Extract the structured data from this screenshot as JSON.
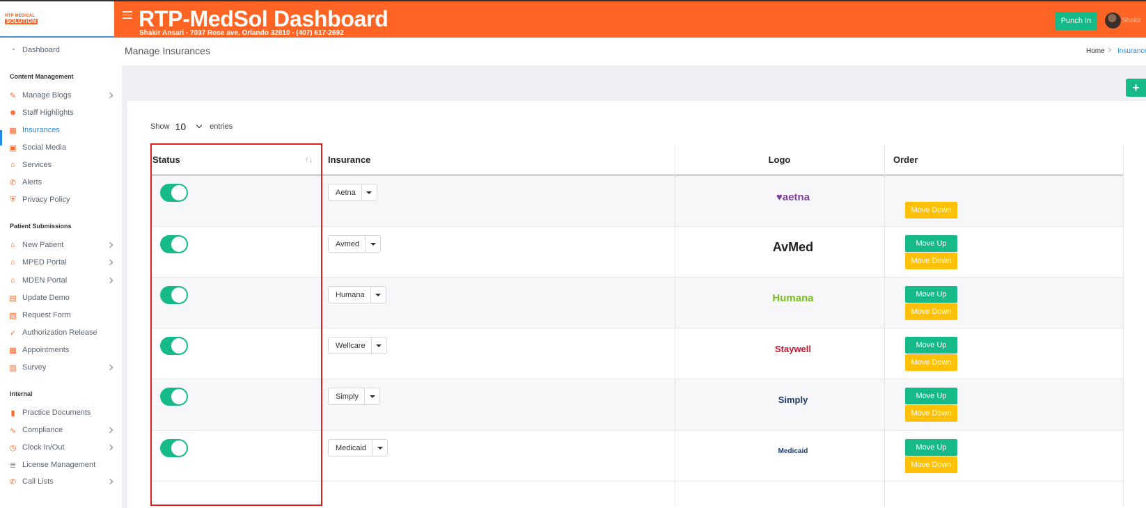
{
  "header": {
    "logo_line1": "RTP MEDICAL",
    "logo_line2": "SOLUTION",
    "title": "RTP-MedSol Dashboard",
    "subtitle": "Shakir Ansari - 7037 Rose ave, Orlando 32810 - (407) 617-2692",
    "punch_label": "Punch In",
    "user_name": "Shakir"
  },
  "sidebar": {
    "dashboard": "Dashboard",
    "sections": [
      "Content Management",
      "Patient Submissions",
      "Internal"
    ],
    "items": [
      {
        "label": "Manage Blogs",
        "icon": "blog-icon",
        "chevron": true
      },
      {
        "label": "Staff Highlights",
        "icon": "staff-icon",
        "chevron": false
      },
      {
        "label": "Insurances",
        "icon": "building-icon",
        "chevron": false,
        "active": true
      },
      {
        "label": "Social Media",
        "icon": "social-icon",
        "chevron": false
      },
      {
        "label": "Services",
        "icon": "bell-service-icon",
        "chevron": false
      },
      {
        "label": "Alerts",
        "icon": "phone-icon",
        "chevron": false
      },
      {
        "label": "Privacy Policy",
        "icon": "shield-icon",
        "chevron": false
      },
      {
        "label": "New Patient",
        "icon": "home-icon",
        "chevron": true
      },
      {
        "label": "MPED Portal",
        "icon": "home-icon",
        "chevron": true
      },
      {
        "label": "MDEN Portal",
        "icon": "home-icon",
        "chevron": true
      },
      {
        "label": "Update Demo",
        "icon": "id-card-icon",
        "chevron": false
      },
      {
        "label": "Request Form",
        "icon": "file-icon",
        "chevron": false
      },
      {
        "label": "Authorization Release",
        "icon": "check-doc-icon",
        "chevron": false
      },
      {
        "label": "Appointments",
        "icon": "calendar-icon",
        "chevron": false
      },
      {
        "label": "Survey",
        "icon": "chart-icon",
        "chevron": true
      },
      {
        "label": "Practice Documents",
        "icon": "clipboard-icon",
        "chevron": false
      },
      {
        "label": "Compliance",
        "icon": "signature-icon",
        "chevron": true
      },
      {
        "label": "Clock In/Out",
        "icon": "clock-icon",
        "chevron": true
      },
      {
        "label": "License Management",
        "icon": "list-icon",
        "chevron": false
      },
      {
        "label": "Call Lists",
        "icon": "phone-icon",
        "chevron": true
      }
    ]
  },
  "page": {
    "title": "Manage Insurances",
    "breadcrumb_home": "Home",
    "breadcrumb_current": "Insurance",
    "add_label": "+",
    "show_label": "Show",
    "entries_value": "10",
    "entries_label": "entries"
  },
  "table": {
    "headers": [
      "Status",
      "Insurance",
      "Logo",
      "Order"
    ],
    "sort_glyph": "↑↓",
    "move_up_label": "Move Up",
    "move_down_label": "Move Down",
    "rows": [
      {
        "name": "Aetna",
        "logo_text": "♥aetna",
        "logo_color": "#7d3f98",
        "active": true,
        "has_up": false
      },
      {
        "name": "Avmed",
        "logo_text": "AvMed",
        "logo_color": "#222222",
        "active": true,
        "has_up": true
      },
      {
        "name": "Humana",
        "logo_text": "Humana",
        "logo_color": "#78be20",
        "active": true,
        "has_up": true
      },
      {
        "name": "Wellcare",
        "logo_text": "Staywell",
        "logo_color": "#c8102e",
        "active": true,
        "has_up": true
      },
      {
        "name": "Simply",
        "logo_text": "Simply",
        "logo_color": "#1f3a68",
        "active": true,
        "has_up": true
      },
      {
        "name": "Medicaid",
        "logo_text": "Medicaid",
        "logo_color": "#1f3a68",
        "active": true,
        "has_up": true
      }
    ]
  },
  "colors": {
    "brand_orange": "#fe6423",
    "success_green": "#16b988",
    "warning_yellow": "#fec107",
    "link_blue": "#1e88e5",
    "highlight_red": "#e41c1c"
  }
}
